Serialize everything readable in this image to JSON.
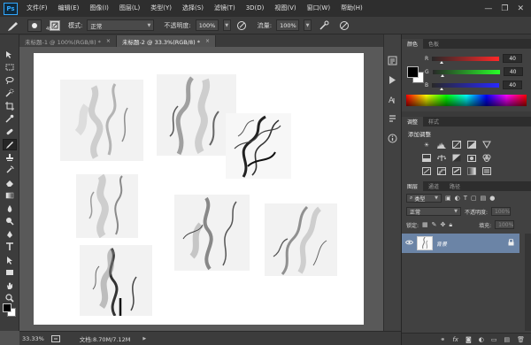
{
  "app": {
    "logo": "Ps"
  },
  "menu": {
    "items": [
      "文件(F)",
      "编辑(E)",
      "图像(I)",
      "图层(L)",
      "类型(Y)",
      "选择(S)",
      "滤镜(T)",
      "3D(D)",
      "视图(V)",
      "窗口(W)",
      "帮助(H)"
    ]
  },
  "window_controls": {
    "minimize": "—",
    "restore": "❐",
    "close": "✕"
  },
  "options": {
    "brush_size": "481",
    "mode_label": "模式:",
    "mode_value": "正常",
    "opacity_label": "不透明度:",
    "opacity_value": "100%",
    "flow_label": "流量:",
    "flow_value": "100%"
  },
  "tabs": [
    {
      "label": "未标题-1 @ 100%(RGB/8) *",
      "close": "×"
    },
    {
      "label": "未标题-2 @ 33.3%(RGB/8) *",
      "close": "×"
    }
  ],
  "tools": [
    "move",
    "marquee",
    "lasso",
    "quick-select",
    "crop",
    "eyedropper",
    "spot-heal",
    "brush",
    "clone-stamp",
    "history-brush",
    "eraser",
    "gradient",
    "blur",
    "dodge",
    "pen",
    "type",
    "path-select",
    "rectangle",
    "hand",
    "zoom"
  ],
  "status": {
    "zoom": "33.33%",
    "doc_info": "文档:8.70M/7.12M"
  },
  "color_panel": {
    "tabs": [
      "颜色",
      "色板"
    ],
    "channels": [
      {
        "label": "R",
        "value": "40"
      },
      {
        "label": "G",
        "value": "40"
      },
      {
        "label": "B",
        "value": "40"
      }
    ],
    "foreground": "#000000",
    "background": "#ffffff"
  },
  "adjustments_panel": {
    "tabs": [
      "调整",
      "样式"
    ],
    "title": "添加调整"
  },
  "layers_panel": {
    "tabs": [
      "图层",
      "通道",
      "路径"
    ],
    "filter_label": "类型",
    "blend_mode": "正常",
    "opacity_label": "不透明度:",
    "opacity_value": "100%",
    "lock_label": "锁定:",
    "fill_label": "填充:",
    "fill_value": "100%",
    "layers": [
      {
        "name": "背景",
        "visible": true,
        "locked": true
      }
    ]
  },
  "colors": {
    "selected_layer": "#6b84a6",
    "ps_blue": "#31a8ff"
  }
}
